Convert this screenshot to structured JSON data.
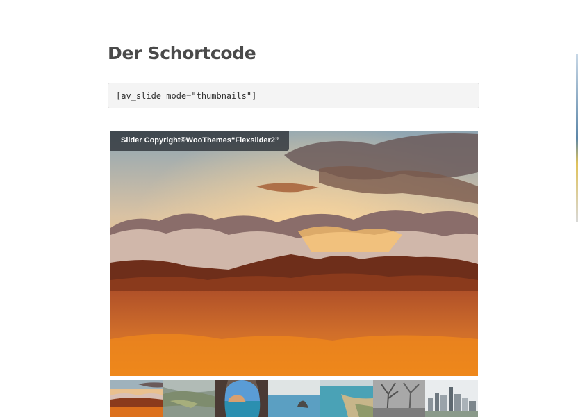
{
  "section": {
    "title": "Der Schortcode",
    "shortcode": "[av_slide mode=\"thumbnails\"]"
  },
  "slider": {
    "caption": "Slider Copyright©WooThemes“Flexslider2”",
    "image": "mountain-sunset-clouds",
    "colors": {
      "sky_top": "#8fa6b4",
      "sky_glow": "#f6c486",
      "fog": "#e8862c",
      "mountain": "#7a3418"
    }
  },
  "thumbnails": [
    {
      "label": "mountain-sunset-thumb"
    },
    {
      "label": "green-valley-thumb"
    },
    {
      "label": "sea-cave-arch-thumb"
    },
    {
      "label": "sea-rock-thumb"
    },
    {
      "label": "coastal-bay-thumb"
    },
    {
      "label": "misty-forest-thumb"
    },
    {
      "label": "city-skyline-thumb"
    }
  ]
}
